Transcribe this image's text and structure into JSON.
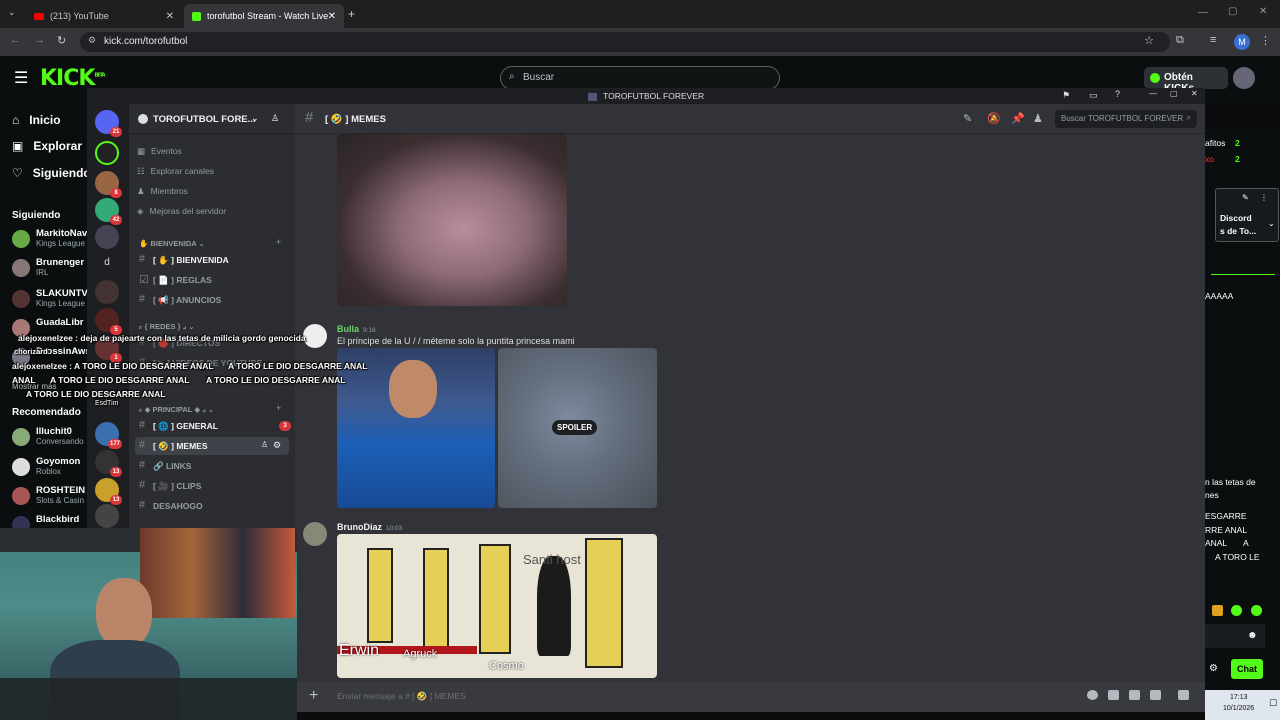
{
  "browser": {
    "tabs": [
      {
        "title": "(213) YouTube"
      },
      {
        "title": "torofutbol Stream - Watch Live"
      }
    ],
    "url": "kick.com/torofutbol",
    "profile_initial": "M"
  },
  "kick": {
    "logo": "KICK",
    "logo_beta": "BETA",
    "search_placeholder": "Buscar",
    "cta": "Obtén KICKs",
    "nav": [
      {
        "label": "Inicio",
        "icon": "home-icon"
      },
      {
        "label": "Explorar",
        "icon": "compass-icon"
      },
      {
        "label": "Siguiendo",
        "icon": "heart-icon"
      }
    ],
    "following_title": "Siguiendo",
    "following": [
      {
        "name": "MarkitoNav",
        "sub": "Kings League"
      },
      {
        "name": "Brunenger",
        "sub": "IRL"
      },
      {
        "name": "SLAKUNTV",
        "sub": "Kings League"
      },
      {
        "name": "GuadaLibr",
        "sub": ""
      },
      {
        "name": "DrossinAws",
        "sub": ""
      }
    ],
    "show_more": "Mostrar más",
    "recommended_title": "Recomendado",
    "recommended": [
      {
        "name": "Illuchit0",
        "sub": "Conversando"
      },
      {
        "name": "Goyomon",
        "sub": "Roblox"
      },
      {
        "name": "ROSHTEIN",
        "sub": "Slots & Casin"
      },
      {
        "name": "Blackbird",
        "sub": ""
      }
    ],
    "right_col": {
      "lines": [
        "afitos",
        "xo",
        "AAAAA",
        "n las tetas de",
        "nes",
        "ESGARRE",
        "RRE ANAL",
        "ANAL",
        "A",
        "A TORO LE"
      ],
      "counts": [
        "2",
        "2"
      ],
      "discord_label": "Discord",
      "discord_sub": "s de To...",
      "chat_button": "Chat",
      "clock_time": "17:13",
      "clock_date": "10/1/2026"
    }
  },
  "discord": {
    "window_title": "TOROFUTBOL FOREVER",
    "server_name": "TOROFUTBOL FORE...",
    "guild_badges": [
      "21",
      "8",
      "42",
      "5",
      "1",
      "177",
      "13",
      "13"
    ],
    "guild_letter": "d",
    "server_items": [
      "Eventos",
      "Explorar canales",
      "Miembros",
      "Mejoras del servidor"
    ],
    "categories": [
      {
        "label": "BIENVENIDA"
      },
      {
        "label": "REDES"
      },
      {
        "label": "PRINCIPAL"
      }
    ],
    "channels_bienvenida": [
      "BIENVENIDA",
      "REGLAS",
      "ANUNCIOS"
    ],
    "channels_redes": [
      "DIRECTOS",
      "VIDEOS DE YOUTUBE"
    ],
    "channels_principal": [
      {
        "name": "GENERAL",
        "badge": "3"
      },
      {
        "name": "MEMES",
        "badge": ""
      },
      {
        "name": "LINKS",
        "badge": ""
      },
      {
        "name": "CLIPS",
        "badge": ""
      },
      {
        "name": "DESAHOGO",
        "badge": ""
      }
    ],
    "current_channel": "MEMES",
    "search_placeholder": "Buscar TOROFUTBOL FOREVER",
    "messages": [
      {
        "author": "Bulla",
        "time": "9:18",
        "text": "El príncipe de la U / / méteme solo la puntita princesa mami",
        "spoiler_label": "SPOILER"
      },
      {
        "author": "BrunoDiaz",
        "time": "10:03",
        "meme_labels": [
          "Santi host",
          "Erwin",
          "Agruck",
          "Cosmo"
        ]
      }
    ],
    "composer_placeholder": "Enviar mensaje a #",
    "composer_channel": "MEMES"
  },
  "overlay_chat": [
    "alejoxenelzee : deja de pajearte con las tetas de milicia gordo genocida",
    "chorizard",
    "alejoxenelzee : A TORO LE DIO DESGARRE ANAL",
    "A TORO LE DIO DESGARRE ANAL",
    "ANAL",
    "A TORO LE DIO DESGARRE ANAL",
    "A TORO LE DIO DESGARRE ANAL",
    "A TORO LE DIO DESGARRE ANAL",
    "EsdTim"
  ]
}
